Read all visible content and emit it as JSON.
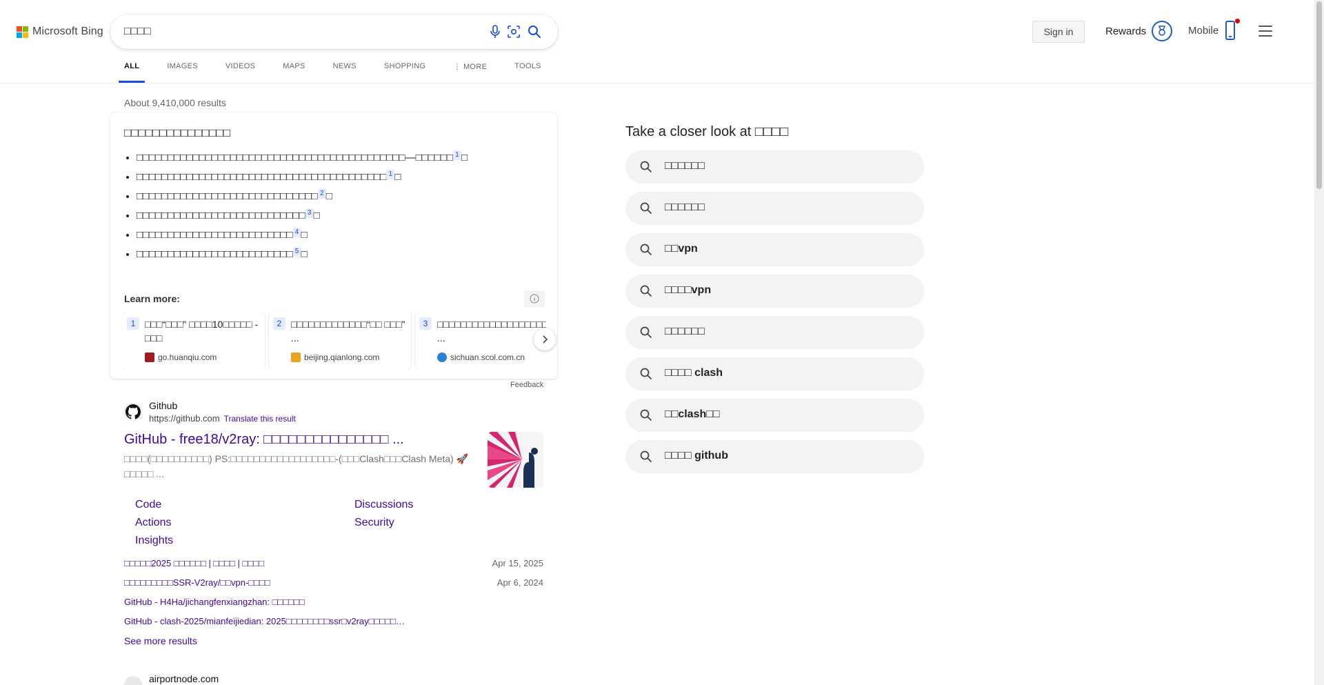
{
  "header": {
    "logo_text": "Microsoft Bing",
    "search_value": "□□□□",
    "sign_in": "Sign in",
    "rewards": "Rewards",
    "mobile": "Mobile"
  },
  "nav": {
    "tabs": [
      {
        "label": "ALL",
        "active": true
      },
      {
        "label": "IMAGES"
      },
      {
        "label": "VIDEOS"
      },
      {
        "label": "MAPS"
      },
      {
        "label": "NEWS"
      },
      {
        "label": "SHOPPING"
      },
      {
        "label": "⋮ MORE"
      },
      {
        "label": "TOOLS"
      }
    ]
  },
  "results_count": "About 9,410,000 results",
  "answer": {
    "title": "□□□□□□□□□□□□□□□",
    "bullets": [
      {
        "text": "□□□□□□□□□□□□□□□□□□□□□□□□□□□□□□□□□□□□□□□□□□□—□□□□□□",
        "cite": "1",
        "tail": "□"
      },
      {
        "text": "□□□□□□□□□□□□□□□□□□□□□□□□□□□□□□□□□□□□□□□□",
        "cite": "1",
        "tail": "□"
      },
      {
        "text": "□□□□□□□□□□□□□□□□□□□□□□□□□□□□□",
        "cite": "2",
        "tail": "□"
      },
      {
        "text": "□□□□□□□□□□□□□□□□□□□□□□□□□□□",
        "cite": "3",
        "tail": "□"
      },
      {
        "text": "□□□□□□□□□□□□□□□□□□□□□□□□□",
        "cite": "4",
        "tail": "□"
      },
      {
        "text": "□□□□□□□□□□□□□□□□□□□□□□□□□",
        "cite": "5",
        "tail": "□"
      }
    ],
    "learn_more": "Learn more:",
    "cards": [
      {
        "num": "1",
        "title": "□□□“□□□” □□□□10□□□□□ - □□□",
        "source": "go.huanqiu.com",
        "fav_color": "#a01c1c"
      },
      {
        "num": "2",
        "title": "□□□□□□□□□□□□□“□□ □□□” ...",
        "source": "beijing.qianlong.com",
        "fav_color": "#e8a320"
      },
      {
        "num": "3",
        "title": "□□□□□□□□□□□□□□□□□□□ ...",
        "source": "sichuan.scol.com.cn",
        "fav_color": "#2a7fd6"
      }
    ],
    "feedback": "Feedback"
  },
  "result": {
    "site_name": "Github",
    "url": "https://github.com",
    "translate": "Translate this result",
    "title": "GitHub - free18/v2ray: □□□□□□□□□□□□□□□ ...",
    "snippet": "□□□□(□□□□□□□□□□) PS:□□□□□□□□□□□□□□□□□□-(□□□Clash□□□Clash Meta) 🚀□□□□□ ...",
    "deeplinks": [
      "Code",
      "Discussions",
      "Actions",
      "Security",
      "Insights"
    ],
    "sublinks": [
      {
        "text": "□□□□□2025 □□□□□□ | □□□□ | □□□□",
        "date": "Apr 15, 2025"
      },
      {
        "text": "□□□□□□□□□SSR-V2ray/□□vpn-□□□□",
        "date": "Apr 6, 2024"
      },
      {
        "text": "GitHub - H4Ha/jichangfenxiangzhan: □□□□□□",
        "date": ""
      },
      {
        "text": "GitHub - clash-2025/mianfeijiedian: 2025□□□□□□□□ssr□v2ray□□□□□…",
        "date": ""
      }
    ],
    "see_more": "See more results"
  },
  "result2": {
    "site_name": "airportnode.com"
  },
  "sidebar": {
    "title": "Take a closer look at □□□□",
    "related": [
      {
        "pre": "□□□□□□",
        "bold": ""
      },
      {
        "pre": "□□□□□□",
        "bold": ""
      },
      {
        "pre": "□□",
        "bold": "vpn"
      },
      {
        "pre": "□□□□",
        "bold": "vpn"
      },
      {
        "pre": "□□□□□□",
        "bold": ""
      },
      {
        "pre": "□□□□ ",
        "bold": "clash"
      },
      {
        "pre": "□□",
        "bold": "clash□□"
      },
      {
        "pre": "□□□□ ",
        "bold": "github"
      }
    ]
  },
  "colors": {
    "accent": "#174ae4",
    "link": "#4007a2"
  }
}
